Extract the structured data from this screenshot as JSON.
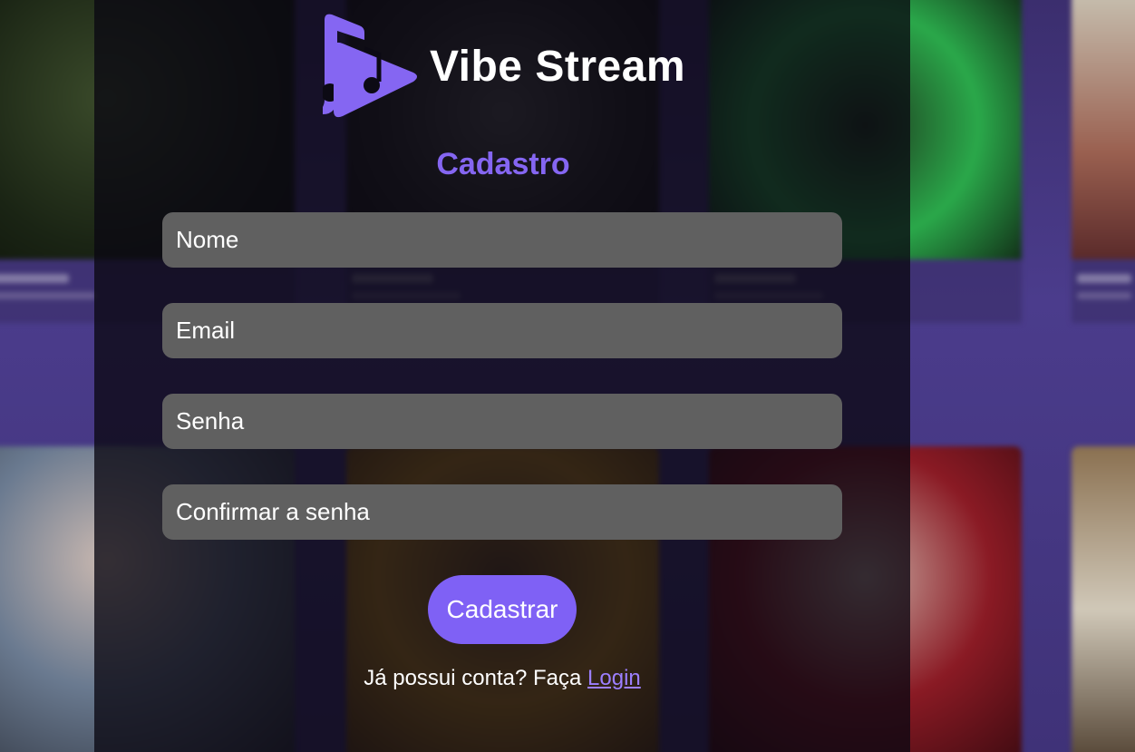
{
  "brand": {
    "name": "Vibe Stream",
    "logo_icon": "music-play-logo-icon",
    "accent_color": "#8566f2"
  },
  "form": {
    "title": "Cadastro",
    "fields": {
      "name_placeholder": "Nome",
      "email_placeholder": "Email",
      "password_placeholder": "Senha",
      "confirm_placeholder": "Confirmar a senha"
    },
    "submit_label": "Cadastrar"
  },
  "footer": {
    "prompt": "Já possui conta? Faça ",
    "login_link": "Login"
  },
  "colors": {
    "panel_overlay": "rgba(10,8,18,0.78)",
    "input_bg": "#606060",
    "button_bg": "#7f61f5",
    "link": "#9c7fff",
    "background": "#4a3a86"
  }
}
